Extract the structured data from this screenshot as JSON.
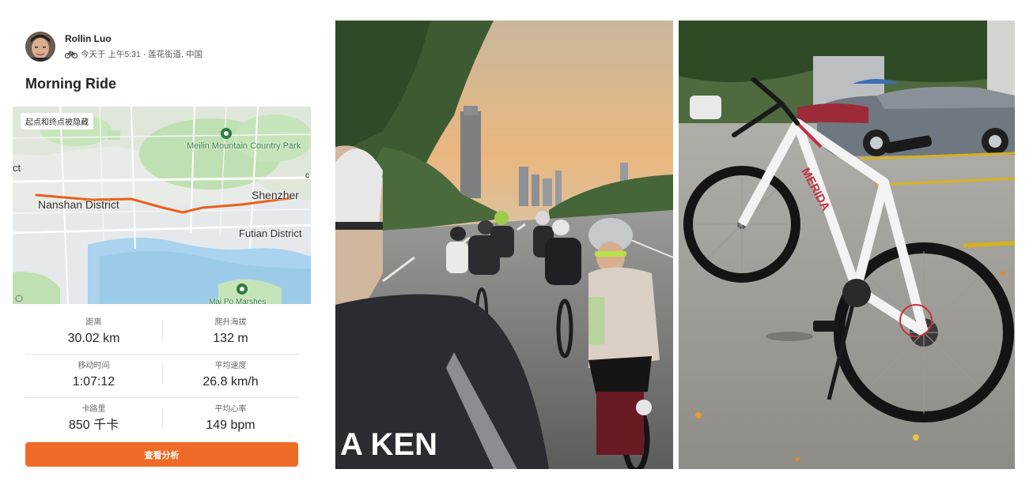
{
  "activity": {
    "athlete_name": "Rollin Luo",
    "meta": "今天于 上午5:31 · 莲花街道, 中国",
    "title": "Morning Ride",
    "sport_icon": "bike-icon"
  },
  "map": {
    "privacy_badge": "起点和终点被隐藏",
    "labels": {
      "meilin_park": "Meilin Mountain Country Park",
      "nanshan": "Nanshan District",
      "shenzhen": "Shenzher",
      "futian": "Futian District",
      "maipo": "Mai Po Marshes",
      "edge_left": "ct",
      "edge_right": "c"
    },
    "route_color": "#e8601c"
  },
  "stats": [
    {
      "label": "距离",
      "value": "30.02 km"
    },
    {
      "label": "爬升海拔",
      "value": "132 m"
    },
    {
      "label": "移动时间",
      "value": "1:07:12"
    },
    {
      "label": "平均速度",
      "value": "26.8 km/h"
    },
    {
      "label": "卡路里",
      "value": "850 千卡"
    },
    {
      "label": "平均心率",
      "value": "149 bpm"
    }
  ],
  "cta": {
    "label": "查看分析",
    "color": "#f06a27"
  },
  "photos": [
    {
      "name": "group-ride-selfie",
      "jersey_text": "A KEN"
    },
    {
      "name": "bike-parked",
      "frame_text": "MERIDA"
    }
  ]
}
